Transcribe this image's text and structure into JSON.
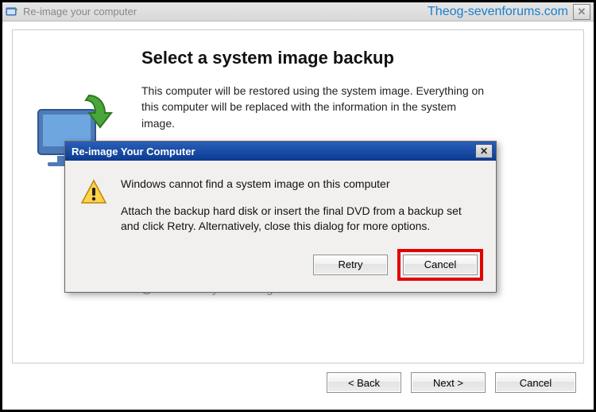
{
  "outer": {
    "title": "Re-image your computer",
    "watermark": "Theog-sevenforums.com"
  },
  "page": {
    "heading": "Select a system image backup",
    "description": "This computer will be restored using the system image. Everything on this computer will be replaced with the information in the system image.",
    "radio_label": "Select a system image"
  },
  "buttons": {
    "back": "< Back",
    "next": "Next >",
    "cancel": "Cancel"
  },
  "modal": {
    "title": "Re-image Your Computer",
    "message1": "Windows cannot find a system image on this computer",
    "message2": "Attach the backup hard disk or insert the final DVD from a backup set and click Retry. Alternatively, close this dialog for more options.",
    "retry": "Retry",
    "cancel": "Cancel"
  }
}
